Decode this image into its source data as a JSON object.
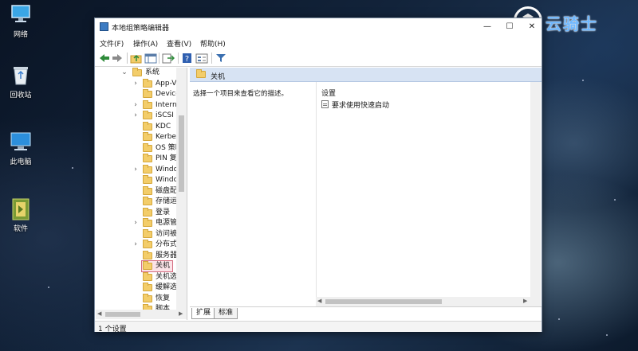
{
  "desktop": {
    "icons": [
      {
        "label": "网络"
      },
      {
        "label": "回收站"
      },
      {
        "label": "此电脑"
      },
      {
        "label": "软件"
      }
    ]
  },
  "watermark": {
    "text": "云骑士"
  },
  "window": {
    "title": "本地组策略编辑器",
    "controls": {
      "minimize": "—",
      "maximize": "☐",
      "close": "✕"
    }
  },
  "menu": {
    "items": [
      "文件(F)",
      "操作(A)",
      "查看(V)",
      "帮助(H)"
    ]
  },
  "toolbar": {
    "icons": [
      "back-icon",
      "forward-icon",
      "up-folder-icon",
      "show-tree-icon",
      "export-icon",
      "help-icon",
      "properties-icon",
      "filter-icon"
    ]
  },
  "tree": {
    "rows": [
      {
        "text": "系统",
        "expander": "⌄"
      },
      {
        "text": "App-V",
        "expander": "›"
      },
      {
        "text": "Device",
        "expander": ""
      },
      {
        "text": "Interne",
        "expander": "›"
      },
      {
        "text": "iSCSI",
        "expander": "›"
      },
      {
        "text": "KDC",
        "expander": ""
      },
      {
        "text": "Kerber",
        "expander": ""
      },
      {
        "text": "OS 策略",
        "expander": ""
      },
      {
        "text": "PIN 复",
        "expander": ""
      },
      {
        "text": "Windo",
        "expander": "›"
      },
      {
        "text": "Windo",
        "expander": ""
      },
      {
        "text": "磁盘配",
        "expander": ""
      },
      {
        "text": "存储运",
        "expander": ""
      },
      {
        "text": "登录",
        "expander": ""
      },
      {
        "text": "电源管",
        "expander": "›"
      },
      {
        "text": "访问被",
        "expander": ""
      },
      {
        "text": "分布式",
        "expander": "›"
      },
      {
        "text": "服务器",
        "expander": ""
      },
      {
        "text": "关机",
        "expander": ""
      },
      {
        "text": "关机选",
        "expander": ""
      },
      {
        "text": "缓解选",
        "expander": ""
      },
      {
        "text": "恢复",
        "expander": ""
      },
      {
        "text": "脚本",
        "expander": ""
      }
    ]
  },
  "right_pane": {
    "header": "关机",
    "description": "选择一个项目来查看它的描述。",
    "column_header": "设置",
    "items": [
      {
        "text": "要求使用快速启动"
      }
    ]
  },
  "tabs": [
    {
      "label": "扩展"
    },
    {
      "label": "标准"
    }
  ],
  "status": {
    "text": "1 个设置"
  }
}
